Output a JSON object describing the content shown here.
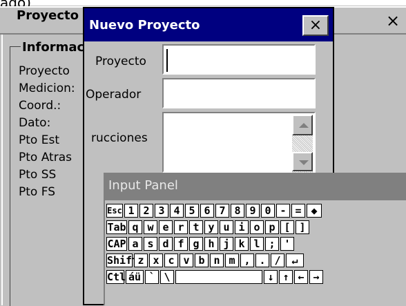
{
  "background_strip": {
    "text": "ado)"
  },
  "background_window": {
    "title": "Proyecto",
    "close_glyph": "×",
    "group_title": "Informac",
    "labels": [
      "Proyecto",
      "Medicion:",
      "Coord.:",
      "Dato:",
      "Pto Est",
      "Pto Atras",
      "Pto SS",
      "Pto FS"
    ]
  },
  "dialog": {
    "title": "Nuevo Proyecto",
    "close_glyph": "×",
    "fields": {
      "proyecto_label": "Proyecto",
      "operador_label": "Operador",
      "instrucciones_label": "rucciones"
    }
  },
  "input_panel": {
    "title": "Input Panel",
    "rows": [
      [
        "Esc",
        "1",
        "2",
        "3",
        "4",
        "5",
        "6",
        "7",
        "8",
        "9",
        "0",
        "-",
        "=",
        "◆"
      ],
      [
        "Tab",
        "q",
        "w",
        "e",
        "r",
        "t",
        "y",
        "u",
        "i",
        "o",
        "p",
        "[",
        "]"
      ],
      [
        "CAP",
        "a",
        "s",
        "d",
        "f",
        "g",
        "h",
        "j",
        "k",
        "l",
        ";",
        "'"
      ],
      [
        "Shift",
        "z",
        "x",
        "c",
        "v",
        "b",
        "n",
        "m",
        ",",
        ".",
        "/",
        "↵"
      ],
      [
        "Ctl",
        "áü",
        "`",
        "\\",
        "↓",
        "↑",
        "←",
        "→"
      ]
    ]
  }
}
